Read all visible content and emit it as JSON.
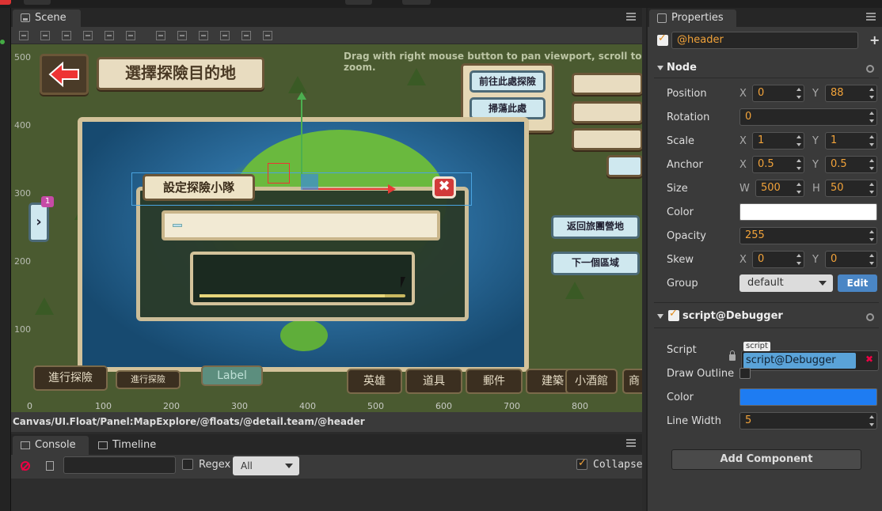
{
  "scene": {
    "tab_label": "Scene",
    "hint": "Drag with right mouse button to pan viewport, scroll to zoom.",
    "ruler_y": [
      "500",
      "400",
      "300",
      "200",
      "100"
    ],
    "ruler_x": [
      "0",
      "100",
      "200",
      "300",
      "400",
      "500",
      "600",
      "700",
      "800"
    ],
    "breadcrumb": "Canvas/UI.Float/Panel:MapExplore/@floats/@detail.team/@header",
    "game": {
      "title": "選擇探險目的地",
      "explore_here": "前往此處探險",
      "sweep_here": "掃蕩此處",
      "dialog_title": "設定探險小隊",
      "back_to_camp": "返回旅團營地",
      "next_area": "下一個區域",
      "badge": "1",
      "label_placeholder": "Label",
      "bottom_tabs": [
        "進行探險",
        "進行探險",
        "英雄",
        "道具",
        "郵件",
        "建築",
        "小酒館",
        "商"
      ],
      "team_progress": 0.9
    }
  },
  "console": {
    "tab_console": "Console",
    "tab_timeline": "Timeline",
    "regex_label": "Regex",
    "filter_value": "All",
    "collapse_label": "Collapse",
    "collapse_checked": true
  },
  "properties": {
    "tab_label": "Properties",
    "node_name": "@header",
    "node_section": "Node",
    "position_label": "Position",
    "position_x": "0",
    "position_y": "88",
    "rotation_label": "Rotation",
    "rotation": "0",
    "scale_label": "Scale",
    "scale_x": "1",
    "scale_y": "1",
    "anchor_label": "Anchor",
    "anchor_x": "0.5",
    "anchor_y": "0.5",
    "size_label": "Size",
    "size_w": "500",
    "size_h": "50",
    "color_label": "Color",
    "color_value": "#ffffff",
    "opacity_label": "Opacity",
    "opacity": "255",
    "skew_label": "Skew",
    "skew_x": "0",
    "skew_y": "0",
    "group_label": "Group",
    "group": "default",
    "edit_label": "Edit",
    "axis_x": "X",
    "axis_y": "Y",
    "axis_w": "W",
    "axis_h": "H",
    "script_section": "script@Debugger",
    "script_label": "Script",
    "script_tag": "script",
    "script_value": "script@Debugger",
    "draw_outline_label": "Draw Outline",
    "debug_color_label": "Color",
    "debug_color_value": "#1e7cf2",
    "line_width_label": "Line Width",
    "line_width": "5",
    "add_component": "Add Component"
  },
  "colors": {
    "accent": "#f2a33a",
    "panel": "#3a3a3a",
    "edit_button": "#4a86c5"
  }
}
